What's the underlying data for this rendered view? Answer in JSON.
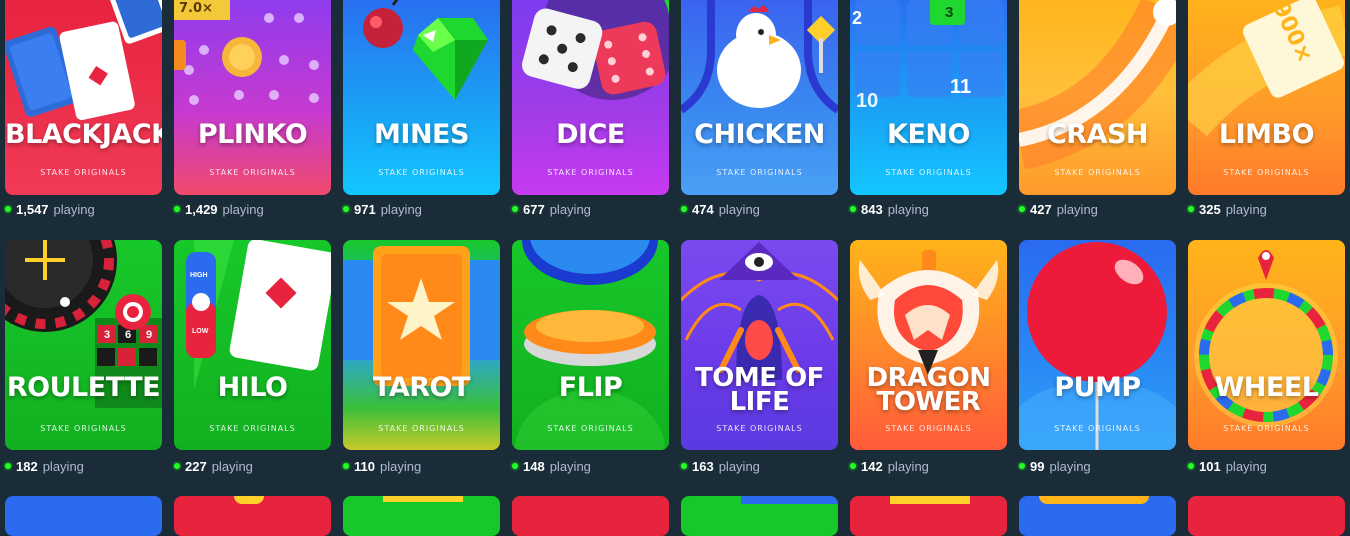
{
  "section_subtitle": "STAKE ORIGINALS",
  "playing_suffix": "playing",
  "colors": {
    "online_dot": "#1fff20",
    "background": "#1a2c38"
  },
  "games": [
    {
      "title_lines": [
        "BLACKJACK"
      ],
      "count": "1,547",
      "icon": "playing-cards-icon"
    },
    {
      "title_lines": [
        "PLINKO"
      ],
      "count": "1,429",
      "badge": "7.0×",
      "icon": "plinko-ball-icon"
    },
    {
      "title_lines": [
        "MINES"
      ],
      "count": "971",
      "icon": "gem-icon"
    },
    {
      "title_lines": [
        "DICE"
      ],
      "count": "677",
      "icon": "dice-icon"
    },
    {
      "title_lines": [
        "CHICKEN"
      ],
      "count": "474",
      "icon": "chicken-icon"
    },
    {
      "title_lines": [
        "KENO"
      ],
      "count": "843",
      "numbers": [
        "2",
        "10",
        "11",
        "3"
      ],
      "icon": "keno-tile-icon"
    },
    {
      "title_lines": [
        "CRASH"
      ],
      "count": "427",
      "icon": "rocket-trail-icon"
    },
    {
      "title_lines": [
        "LIMBO"
      ],
      "count": "325",
      "multiplier": "900×",
      "icon": "multiplier-card-icon"
    },
    {
      "title_lines": [
        "ROULETTE"
      ],
      "count": "182",
      "numbers": [
        "3",
        "6",
        "9"
      ],
      "icon": "roulette-wheel-icon"
    },
    {
      "title_lines": [
        "HILO"
      ],
      "count": "227",
      "labels": [
        "HIGH",
        "LOW"
      ],
      "icon": "hilo-card-icon"
    },
    {
      "title_lines": [
        "TAROT"
      ],
      "count": "110",
      "icon": "tarot-card-icon"
    },
    {
      "title_lines": [
        "FLIP"
      ],
      "count": "148",
      "icon": "coin-icon"
    },
    {
      "title_lines": [
        "TOME OF",
        "LIFE"
      ],
      "count": "163",
      "icon": "eye-icon"
    },
    {
      "title_lines": [
        "DRAGON",
        "TOWER"
      ],
      "count": "142",
      "icon": "dragon-egg-icon"
    },
    {
      "title_lines": [
        "PUMP"
      ],
      "count": "99",
      "icon": "balloon-icon"
    },
    {
      "title_lines": [
        "WHEEL"
      ],
      "count": "101",
      "icon": "wheel-icon"
    }
  ]
}
